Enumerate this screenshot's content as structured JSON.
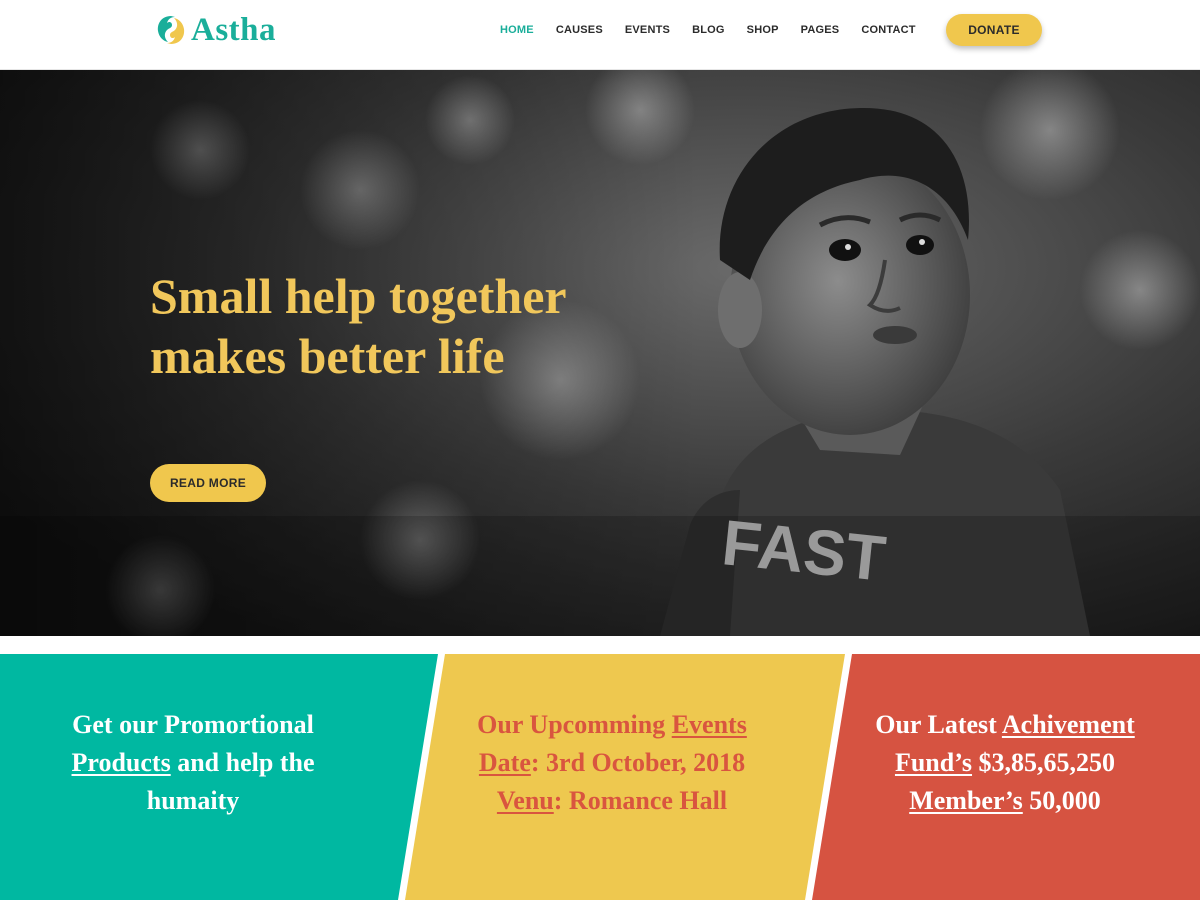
{
  "brand": {
    "name": "Astha"
  },
  "nav": {
    "items": [
      {
        "label": "HOME",
        "active": true
      },
      {
        "label": "CAUSES",
        "active": false
      },
      {
        "label": "EVENTS",
        "active": false
      },
      {
        "label": "BLOG",
        "active": false
      },
      {
        "label": "SHOP",
        "active": false
      },
      {
        "label": "PAGES",
        "active": false
      },
      {
        "label": "CONTACT",
        "active": false
      }
    ],
    "donate_label": "DONATE"
  },
  "hero": {
    "title": "Small help together makes better life",
    "cta_label": "READ MORE",
    "image": "child-photo-grayscale"
  },
  "panels": {
    "promo": {
      "before": "Get our Promortional",
      "link": "Products",
      "after": "and help the humaity"
    },
    "events": {
      "intro": "Our Upcomming",
      "date_link": "Events Date",
      "date_value": ": 3rd October, 2018",
      "venue_link": "Venu",
      "venue_value": ": Romance Hall"
    },
    "achievement": {
      "intro": "Our Latest",
      "intro_link": "Achivement",
      "fund_link": "Fund’s",
      "fund_value": "$3,85,65,250",
      "member_link": "Member’s",
      "member_value": "50,000"
    }
  },
  "colors": {
    "accent": "#1aae9a",
    "yellow": "#f0c74d",
    "teal_panel": "#00b8a1",
    "yellow_panel": "#eec84f",
    "red_panel": "#d65341",
    "hero_title": "#f1c75b"
  }
}
